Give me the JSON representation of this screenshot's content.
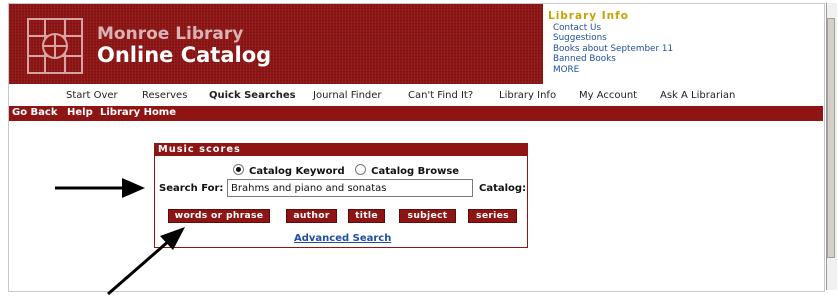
{
  "header": {
    "library_name": "Monroe Library",
    "catalog_name": "Online Catalog"
  },
  "library_info": {
    "title": "Library Info",
    "links": [
      "Contact Us",
      "Suggestions",
      "Books about September 11",
      "Banned Books",
      "MORE"
    ]
  },
  "nav": {
    "items": [
      "Start Over",
      "Reserves",
      "Quick Searches",
      "Journal Finder",
      "Can't Find It?",
      "Library Info",
      "My Account",
      "Ask A Librarian"
    ],
    "active": "Quick Searches"
  },
  "subnav": {
    "items": [
      "Go Back",
      "Help",
      "Library Home"
    ]
  },
  "search_panel": {
    "title": "Music scores",
    "radio_options": [
      "Catalog Keyword",
      "Catalog Browse"
    ],
    "selected_option": "Catalog Keyword",
    "search_label": "Search For:",
    "search_value": "Brahms and piano and sonatas",
    "catalog_label": "Catalog:",
    "buttons": [
      "words or phrase",
      "author",
      "title",
      "subject",
      "series"
    ],
    "advanced_link": "Advanced Search"
  },
  "colors": {
    "brand_red": "#8f1515",
    "info_title": "#c8a200",
    "link_blue": "#1f4fa0"
  }
}
